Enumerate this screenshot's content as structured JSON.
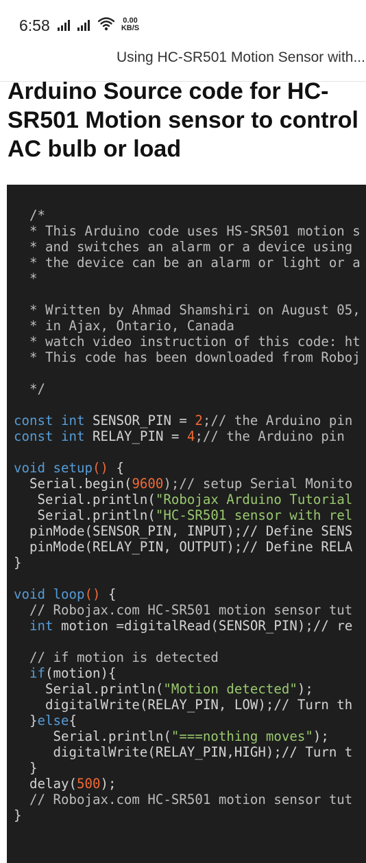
{
  "status_bar": {
    "time": "6:58",
    "net_speed_value": "0.00",
    "net_speed_unit": "KB/S",
    "icons": [
      "signal-icon",
      "signal-icon",
      "wifi-icon"
    ]
  },
  "page_header": {
    "title": "Using HC-SR501 Motion Sensor with..."
  },
  "article": {
    "heading_lines": [
      "Arduino Source code for HC-",
      "SR501 Motion sensor to control",
      "AC bulb or load"
    ]
  },
  "code": {
    "colors": {
      "background": "#1e1e1e",
      "comment": "#bdbdbd",
      "keyword": "#569cd6",
      "default": "#d4d4d4",
      "number": "#f06a36",
      "string": "#9ac96f"
    },
    "lines": [
      [
        {
          "t": "  /*",
          "c": "comment"
        }
      ],
      [
        {
          "t": "  * This Arduino code uses HS-SR501 motion s",
          "c": "comment"
        }
      ],
      [
        {
          "t": "  * and switches an alarm or a device using ",
          "c": "comment"
        }
      ],
      [
        {
          "t": "  * the device can be an alarm or light or a",
          "c": "comment"
        }
      ],
      [
        {
          "t": "  *",
          "c": "comment"
        }
      ],
      [],
      [
        {
          "t": "  * Written by Ahmad Shamshiri on August 05,",
          "c": "comment"
        }
      ],
      [
        {
          "t": "  * in Ajax, Ontario, Canada",
          "c": "comment"
        }
      ],
      [
        {
          "t": "  * watch video instruction of this code: ht",
          "c": "comment"
        }
      ],
      [
        {
          "t": "  * This code has been downloaded from Roboj",
          "c": "comment"
        }
      ],
      [],
      [
        {
          "t": "  */",
          "c": "comment"
        }
      ],
      [],
      [
        {
          "t": "const",
          "c": "keyword"
        },
        {
          "t": " ",
          "c": "default"
        },
        {
          "t": "int",
          "c": "keyword"
        },
        {
          "t": " SENSOR_PIN = ",
          "c": "default"
        },
        {
          "t": "2",
          "c": "number"
        },
        {
          "t": ";// the Arduino pin",
          "c": "comment"
        }
      ],
      [
        {
          "t": "const",
          "c": "keyword"
        },
        {
          "t": " ",
          "c": "default"
        },
        {
          "t": "int",
          "c": "keyword"
        },
        {
          "t": " RELAY_PIN = ",
          "c": "default"
        },
        {
          "t": "4",
          "c": "number"
        },
        {
          "t": ";// the Arduino pin ",
          "c": "comment"
        }
      ],
      [],
      [
        {
          "t": "void",
          "c": "keyword"
        },
        {
          "t": " ",
          "c": "default"
        },
        {
          "t": "setup",
          "c": "keyword"
        },
        {
          "t": "()",
          "c": "number"
        },
        {
          "t": " {",
          "c": "default"
        }
      ],
      [
        {
          "t": "  Serial.begin(",
          "c": "default"
        },
        {
          "t": "9600",
          "c": "number"
        },
        {
          "t": ");// setup Serial Monito",
          "c": "comment"
        }
      ],
      [
        {
          "t": "   Serial.println(",
          "c": "default"
        },
        {
          "t": "\"Robojax Arduino Tutorial",
          "c": "string"
        }
      ],
      [
        {
          "t": "   Serial.println(",
          "c": "default"
        },
        {
          "t": "\"HC-SR501 sensor with rel",
          "c": "string"
        }
      ],
      [
        {
          "t": "  pinMode(SENSOR_PIN, INPUT);// Define SENS",
          "c": "default"
        }
      ],
      [
        {
          "t": "  pinMode(RELAY_PIN, OUTPUT);// Define RELA",
          "c": "default"
        }
      ],
      [
        {
          "t": "}",
          "c": "default"
        }
      ],
      [],
      [
        {
          "t": "void",
          "c": "keyword"
        },
        {
          "t": " ",
          "c": "default"
        },
        {
          "t": "loop",
          "c": "keyword"
        },
        {
          "t": "()",
          "c": "number"
        },
        {
          "t": " {",
          "c": "default"
        }
      ],
      [
        {
          "t": "  // Robojax.com HC-SR501 motion sensor tut",
          "c": "comment"
        }
      ],
      [
        {
          "t": "  ",
          "c": "default"
        },
        {
          "t": "int",
          "c": "keyword"
        },
        {
          "t": " motion =digitalRead(SENSOR_PIN);// re",
          "c": "default"
        }
      ],
      [],
      [
        {
          "t": "  // if motion is detected",
          "c": "comment"
        }
      ],
      [
        {
          "t": "  ",
          "c": "default"
        },
        {
          "t": "if",
          "c": "keyword"
        },
        {
          "t": "(motion){",
          "c": "default"
        }
      ],
      [
        {
          "t": "    Serial.println(",
          "c": "default"
        },
        {
          "t": "\"Motion detected\"",
          "c": "string"
        },
        {
          "t": ");",
          "c": "default"
        }
      ],
      [
        {
          "t": "    digitalWrite(RELAY_PIN, LOW);// Turn th",
          "c": "default"
        }
      ],
      [
        {
          "t": "  }",
          "c": "default"
        },
        {
          "t": "else",
          "c": "keyword"
        },
        {
          "t": "{",
          "c": "default"
        }
      ],
      [
        {
          "t": "     Serial.println(",
          "c": "default"
        },
        {
          "t": "\"===nothing moves\"",
          "c": "string"
        },
        {
          "t": ");",
          "c": "default"
        }
      ],
      [
        {
          "t": "     digitalWrite(RELAY_PIN,HIGH);// Turn t",
          "c": "default"
        }
      ],
      [
        {
          "t": "  }",
          "c": "default"
        }
      ],
      [
        {
          "t": "  delay(",
          "c": "default"
        },
        {
          "t": "500",
          "c": "number"
        },
        {
          "t": ");",
          "c": "default"
        }
      ],
      [
        {
          "t": "  // Robojax.com HC-SR501 motion sensor tut",
          "c": "comment"
        }
      ],
      [
        {
          "t": "}",
          "c": "default"
        }
      ]
    ]
  }
}
